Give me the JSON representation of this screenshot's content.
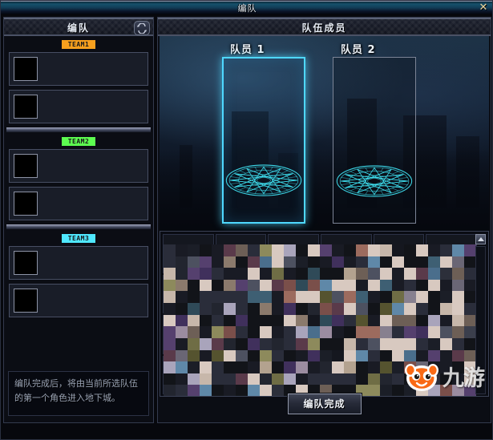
{
  "window": {
    "title": "编队",
    "close_label": "✕"
  },
  "left_panel": {
    "header_title": "编队",
    "refresh_icon": "refresh-swap-icon",
    "teams": [
      {
        "label": "TEAM1",
        "color": "#f7a01e",
        "slots": [
          {
            "name": ""
          },
          {
            "name": ""
          }
        ]
      },
      {
        "label": "TEAM2",
        "color": "#5dfd50",
        "slots": [
          {
            "name": ""
          },
          {
            "name": ""
          }
        ]
      },
      {
        "label": "TEAM3",
        "color": "#4fe8ff",
        "slots": [
          {
            "name": ""
          },
          {
            "name": ""
          }
        ]
      }
    ],
    "hint_text": "编队完成后，将由当前所选队伍的第一个角色进入地下城。"
  },
  "right_panel": {
    "header_title": "队伍成员",
    "members": [
      {
        "label": "队员 1",
        "selected": true,
        "empty": true
      },
      {
        "label": "队员 2",
        "selected": false,
        "empty": true
      }
    ],
    "scroll_up_icon": "arrow-up-icon",
    "roster_columns": 6,
    "roster_rows": 4
  },
  "footer": {
    "confirm_label": "编队完成"
  },
  "watermark": {
    "text": "九游"
  },
  "colors": {
    "accent_cyan": "#4fd8ff",
    "team1": "#f7a01e",
    "team2": "#5dfd50",
    "team3": "#4fe8ff",
    "titlebar_teal": "#15506b",
    "frame_steel": "#4a5165"
  }
}
